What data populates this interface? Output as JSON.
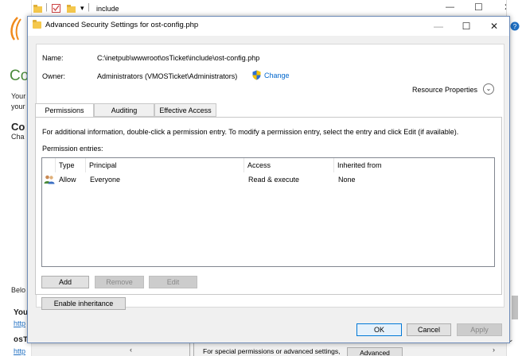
{
  "background": {
    "explorer_path": "include",
    "heading": "Co",
    "line1": "Your",
    "line2": "your",
    "bold_heading": "Co",
    "line3": "Cha",
    "below": "Belo",
    "you_bold": "You",
    "link1": "http",
    "os_bold": "osT",
    "link2": "http",
    "bottom_hint": "For special permissions or advanced settings,",
    "bottom_advanced_button": "Advanced"
  },
  "dialog": {
    "title": "Advanced Security Settings for ost-config.php",
    "name_label": "Name:",
    "name_value": "C:\\inetpub\\wwwroot\\osTicket\\include\\ost-config.php",
    "owner_label": "Owner:",
    "owner_value": "Administrators (VMOSTicket\\Administrators)",
    "change_link": "Change",
    "resource_properties": "Resource Properties",
    "tabs": [
      {
        "label": "Permissions",
        "active": true
      },
      {
        "label": "Auditing",
        "active": false
      },
      {
        "label": "Effective Access",
        "active": false
      }
    ],
    "info_text": "For additional information, double-click a permission entry. To modify a permission entry, select the entry and click Edit (if available).",
    "entries_label": "Permission entries:",
    "columns": [
      "Type",
      "Principal",
      "Access",
      "Inherited from"
    ],
    "rows": [
      {
        "type": "Allow",
        "principal": "Everyone",
        "access": "Read & execute",
        "inherited": "None"
      }
    ],
    "add_button": "Add",
    "remove_button": "Remove",
    "edit_button": "Edit",
    "enable_inheritance_button": "Enable inheritance",
    "ok_button": "OK",
    "cancel_button": "Cancel",
    "apply_button": "Apply"
  },
  "colors": {
    "accent": "#0078d7",
    "link": "#0066cc",
    "heading_green": "#4a8a3a"
  }
}
